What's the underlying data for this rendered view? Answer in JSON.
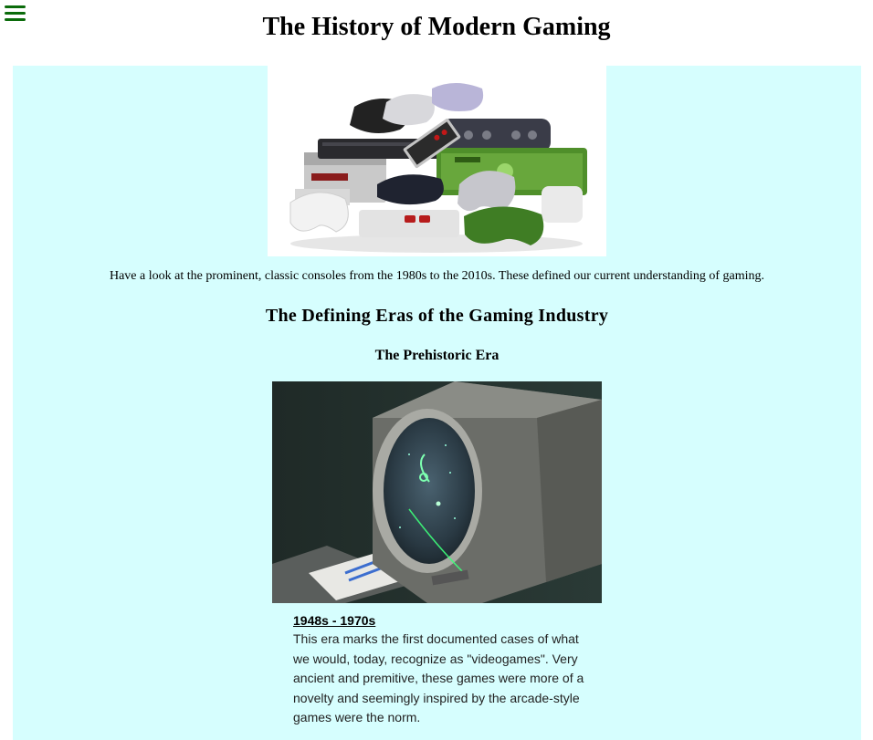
{
  "header": {
    "title": "The History of Modern Gaming",
    "menu_icon": "hamburger-menu-icon",
    "menu_color": "#0b6b0b"
  },
  "intro": {
    "image_alt": "Pile of classic game consoles and controllers",
    "caption": "Have a look at the prominent, classic consoles from the 1980s to the 2010s. These defined our current understanding of gaming."
  },
  "section": {
    "heading": "The Defining Eras of the Gaming Industry",
    "eras": [
      {
        "name": "The Prehistoric Era",
        "image_alt": "Early vector display game on a round oscilloscope screen",
        "dates": "1948s - 1970s",
        "description": "This era marks the first documented cases of what we would, today, recognize as \"videogames\". Very ancient and premitive, these games were more of a novelty and seemingly inspired by the arcade-style games were the norm."
      }
    ]
  },
  "colors": {
    "panel_background": "#d6fefe",
    "page_background": "#ffffff"
  }
}
